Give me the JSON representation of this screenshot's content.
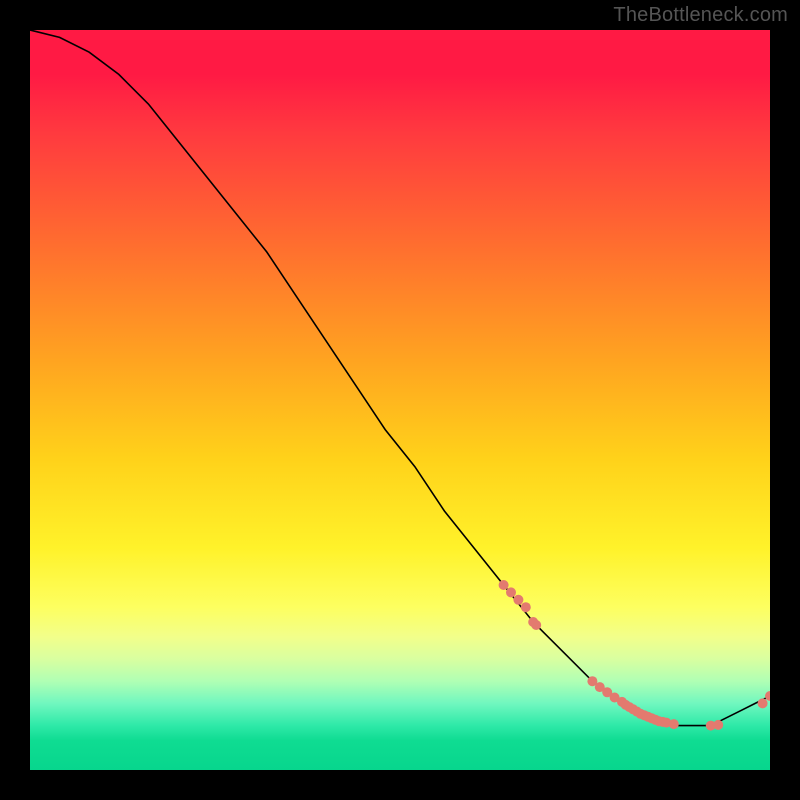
{
  "watermark": "TheBottleneck.com",
  "chart_data": {
    "type": "line",
    "title": "",
    "xlabel": "",
    "ylabel": "",
    "xlim": [
      0,
      100
    ],
    "ylim": [
      0,
      100
    ],
    "series": [
      {
        "name": "curve",
        "color": "#000000",
        "x": [
          0,
          4,
          8,
          12,
          16,
          20,
          24,
          28,
          32,
          36,
          40,
          44,
          48,
          52,
          56,
          60,
          64,
          68,
          72,
          76,
          80,
          84,
          86,
          88,
          90,
          92,
          94,
          96,
          98,
          100
        ],
        "y": [
          100,
          99,
          97,
          94,
          90,
          85,
          80,
          75,
          70,
          64,
          58,
          52,
          46,
          41,
          35,
          30,
          25,
          20,
          16,
          12,
          9,
          7,
          6,
          6,
          6,
          6,
          7,
          8,
          9,
          10
        ]
      }
    ],
    "markers": {
      "name": "dots",
      "color": "#e37a6f",
      "radius_px": 5,
      "x": [
        64,
        65,
        66,
        67,
        68,
        68.4,
        76,
        77,
        78,
        79,
        80,
        80.5,
        81,
        81.5,
        82,
        82.5,
        83,
        83.5,
        84,
        84.5,
        85,
        85.5,
        86,
        87,
        92,
        93,
        99,
        100
      ],
      "y": [
        25,
        24,
        23,
        22,
        20,
        19.6,
        12,
        11.2,
        10.5,
        9.8,
        9.2,
        8.8,
        8.5,
        8.2,
        7.9,
        7.6,
        7.4,
        7.2,
        7.0,
        6.8,
        6.6,
        6.5,
        6.4,
        6.2,
        6.0,
        6.1,
        9,
        10
      ]
    },
    "gradient_stops": [
      {
        "pos": 0.0,
        "color": "#ff1a44"
      },
      {
        "pos": 0.06,
        "color": "#ff1a44"
      },
      {
        "pos": 0.14,
        "color": "#ff3a3f"
      },
      {
        "pos": 0.28,
        "color": "#ff6a30"
      },
      {
        "pos": 0.45,
        "color": "#ffa520"
      },
      {
        "pos": 0.58,
        "color": "#ffd21a"
      },
      {
        "pos": 0.7,
        "color": "#fff22a"
      },
      {
        "pos": 0.78,
        "color": "#fdff60"
      },
      {
        "pos": 0.82,
        "color": "#f2ff8a"
      },
      {
        "pos": 0.85,
        "color": "#d9ffa0"
      },
      {
        "pos": 0.88,
        "color": "#b0ffb4"
      },
      {
        "pos": 0.91,
        "color": "#70f7bf"
      },
      {
        "pos": 0.94,
        "color": "#2ee9a8"
      },
      {
        "pos": 0.96,
        "color": "#0fdc92"
      },
      {
        "pos": 1.0,
        "color": "#07d68d"
      }
    ]
  }
}
